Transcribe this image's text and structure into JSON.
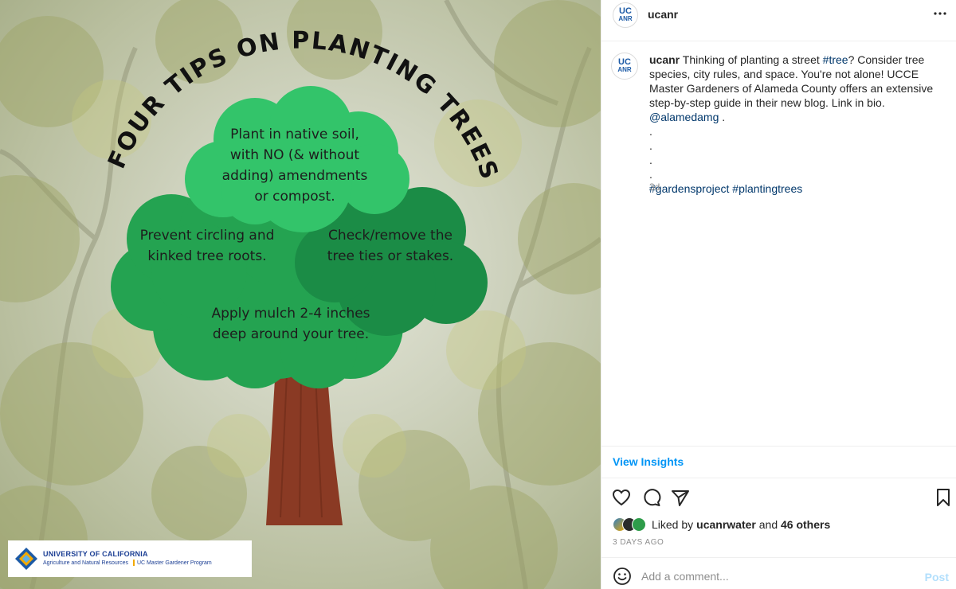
{
  "image": {
    "title_arc": "FOUR TIPS ON PLANTING TREES",
    "tips": {
      "top": [
        "Plant in native soil,",
        "with NO (& without",
        "adding) amendments",
        "or compost."
      ],
      "left": [
        "Prevent circling and",
        "kinked tree roots."
      ],
      "right": [
        "Check/remove the",
        "tree ties or stakes."
      ],
      "bottom": [
        "Apply mulch 2-4 inches",
        "deep around your tree."
      ]
    },
    "logo": {
      "org": "UNIVERSITY OF CALIFORNIA",
      "division": "Agriculture and Natural Resources",
      "program": "UC Master Gardener Program"
    },
    "colors": {
      "foliage_light": "#33c46a",
      "foliage_mid": "#24a351",
      "foliage_dark": "#1b8c46",
      "trunk": "#8a3a24"
    }
  },
  "post": {
    "avatar_line1": "UC",
    "avatar_line2": "ANR",
    "username": "ucanr",
    "more_icon": "ellipsis-icon",
    "caption": {
      "author": "ucanr",
      "text_before_tag": " Thinking of planting a street ",
      "tag_tree": "#tree",
      "text_after_tag": "? Consider tree species, city rules, and space. You're not alone! UCCE Master Gardeners of Alameda County offers an extensive step-by-step guide in their new blog. Link in bio. ",
      "mention": "@alamedamg",
      "after_mention": " .",
      "dots": [
        ".",
        ".",
        ".",
        "."
      ],
      "hashtag1": "#gardensproject",
      "hashtag2": "#plantingtrees"
    },
    "caption_time": "3d",
    "insights_label": "View Insights",
    "likes": {
      "prefix": "Liked by ",
      "user": "ucanrwater",
      "middle": " and ",
      "others": "46 others"
    },
    "date": "3 DAYS AGO",
    "comment_placeholder": "Add a comment...",
    "post_label": "Post"
  }
}
